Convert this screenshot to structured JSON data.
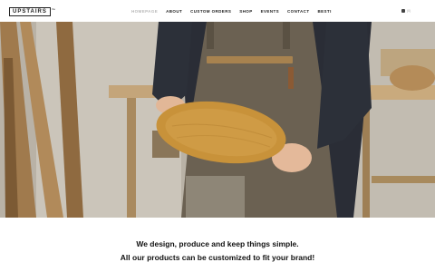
{
  "brand": {
    "logo_text": "UPSTAIRS",
    "logo_sup": "the"
  },
  "nav": {
    "items": [
      {
        "label": "HOMEPAGE",
        "active": true
      },
      {
        "label": "ABOUT",
        "active": false
      },
      {
        "label": "CUSTOM ORDERS",
        "active": false
      },
      {
        "label": "SHOP",
        "active": false
      },
      {
        "label": "EVENTS",
        "active": false
      },
      {
        "label": "CONTACT",
        "active": false
      },
      {
        "label": "BESTI",
        "active": false
      }
    ]
  },
  "cart": {
    "label": "(0)",
    "icon": "bag-icon"
  },
  "hero": {
    "image": "hero-woodworker-holding-round-wooden-board"
  },
  "tagline": {
    "line1": "We design, produce and keep things simple.",
    "line2": "All our products can be customized to fit your brand!"
  },
  "colors": {
    "accent_active": "#b8b8b8",
    "text": "#222222",
    "apron": "#6b6152",
    "wood": "#c8923a"
  }
}
